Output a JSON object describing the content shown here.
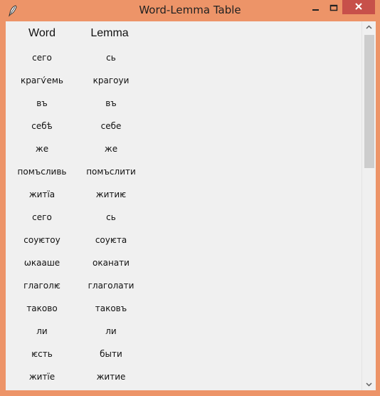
{
  "window": {
    "title": "Word-Lemma Table"
  },
  "icons": {
    "app": "feather-icon",
    "minimize": "minimize-icon",
    "maximize": "maximize-icon",
    "close": "close-icon",
    "scroll_up": "chevron-up-icon",
    "scroll_down": "chevron-down-icon"
  },
  "colors": {
    "window_border": "#ed9468",
    "close_button": "#c7504a",
    "client_background": "#f0f0f0",
    "scroll_thumb": "#cdcdcd"
  },
  "table": {
    "headers": {
      "word": "Word",
      "lemma": "Lemma"
    },
    "rows": [
      {
        "word": "сего",
        "lemma": "сь"
      },
      {
        "word": "крагѵ́емь",
        "lemma": "крагоуи"
      },
      {
        "word": "въ",
        "lemma": "въ"
      },
      {
        "word": "себѣ",
        "lemma": "себе"
      },
      {
        "word": "же",
        "lemma": "же"
      },
      {
        "word": "помъсливь",
        "lemma": "помъслити"
      },
      {
        "word": "житїа",
        "lemma": "житиѥ"
      },
      {
        "word": "сего",
        "lemma": "сь"
      },
      {
        "word": "соуѥтоу",
        "lemma": "соуѥта"
      },
      {
        "word": "ѡкааше",
        "lemma": "оканати"
      },
      {
        "word": "глаголѥ",
        "lemma": "глаголати"
      },
      {
        "word": "таково",
        "lemma": "таковъ"
      },
      {
        "word": "ли",
        "lemma": "ли"
      },
      {
        "word": "ѥсть",
        "lemma": "быти"
      },
      {
        "word": "житїе",
        "lemma": "житие"
      }
    ]
  },
  "scrollbar": {
    "visible_fraction": 0.37,
    "scroll_position": 0.0
  }
}
